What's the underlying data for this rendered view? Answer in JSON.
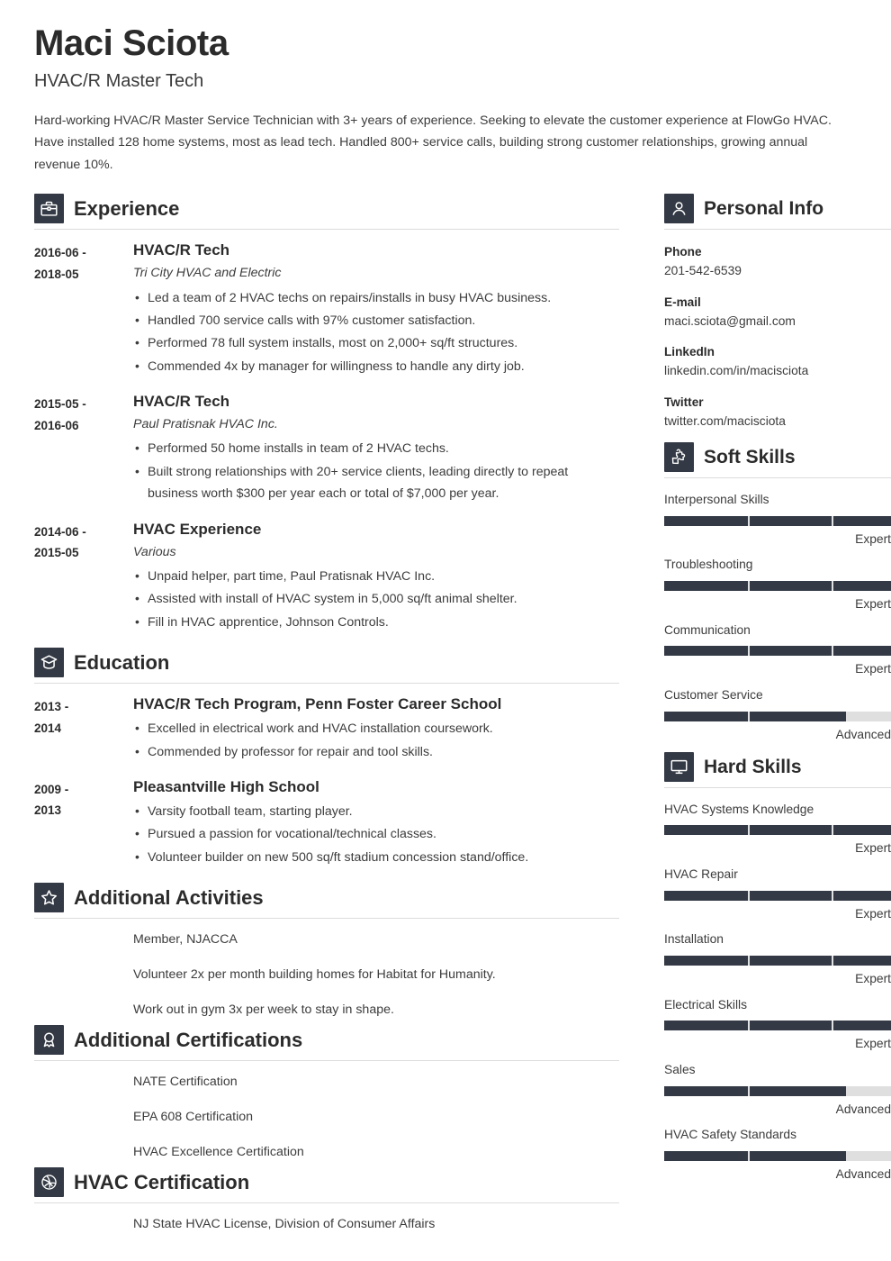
{
  "header": {
    "name": "Maci Sciota",
    "job_title": "HVAC/R Master Tech",
    "summary": "Hard-working HVAC/R Master Service Technician with 3+ years of experience. Seeking to elevate the customer experience at FlowGo HVAC. Have installed 128 home systems, most as lead tech. Handled 800+ service calls, building strong customer relationships, growing annual revenue 10%."
  },
  "theme": {
    "accent": "#343a45",
    "text": "#3c3c3c",
    "heading": "#2b2b2b",
    "rule": "#dcdcdc",
    "bar_empty": "#dfdfdf"
  },
  "sections": {
    "experience": {
      "title": "Experience",
      "icon": "briefcase-icon",
      "entries": [
        {
          "dates": "2016-06 - 2018-05",
          "date_from": "2016-06 -",
          "date_to": "2018-05",
          "title": "HVAC/R Tech",
          "org": "Tri City HVAC and Electric",
          "bullets": [
            "Led a team of 2 HVAC techs on repairs/installs in busy HVAC business.",
            "Handled 700 service calls with 97% customer satisfaction.",
            "Performed 78 full system installs, most on 2,000+ sq/ft structures.",
            "Commended 4x by manager for willingness to handle any dirty job."
          ]
        },
        {
          "dates": "2015-05 - 2016-06",
          "date_from": "2015-05 -",
          "date_to": "2016-06",
          "title": "HVAC/R Tech",
          "org": "Paul Pratisnak HVAC Inc.",
          "bullets": [
            "Performed 50 home installs in team of 2 HVAC techs.",
            "Built strong relationships with 20+ service clients, leading directly to repeat business worth $300 per year each or total of $7,000 per year."
          ]
        },
        {
          "dates": "2014-06 - 2015-05",
          "date_from": "2014-06 -",
          "date_to": "2015-05",
          "title": "HVAC Experience",
          "org": "Various",
          "bullets": [
            "Unpaid helper, part time, Paul Pratisnak HVAC Inc.",
            "Assisted with install of HVAC system in 5,000 sq/ft animal shelter.",
            "Fill in HVAC apprentice, Johnson Controls."
          ]
        }
      ]
    },
    "education": {
      "title": "Education",
      "icon": "graduation-cap-icon",
      "entries": [
        {
          "date_from": "2013 -",
          "date_to": "2014",
          "title": "HVAC/R Tech Program, Penn Foster Career School",
          "org": "",
          "bullets": [
            "Excelled in electrical work and HVAC installation coursework.",
            "Commended by professor for repair and tool skills."
          ]
        },
        {
          "date_from": "2009 -",
          "date_to": "2013",
          "title": "Pleasantville High School",
          "org": "",
          "bullets": [
            "Varsity football team, starting player.",
            "Pursued a passion for vocational/technical classes.",
            "Volunteer builder on new 500 sq/ft stadium concession stand/office."
          ]
        }
      ]
    },
    "additional_activities": {
      "title": "Additional Activities",
      "icon": "star-icon",
      "items": [
        "Member, NJACCA",
        "Volunteer 2x per month building homes for Habitat for Humanity.",
        "Work out in gym 3x per week to stay in shape."
      ]
    },
    "additional_certifications": {
      "title": "Additional Certifications",
      "icon": "award-ribbon-icon",
      "items": [
        "NATE Certification",
        "EPA 608 Certification",
        "HVAC Excellence Certification"
      ]
    },
    "hvac_certification": {
      "title": "HVAC Certification",
      "icon": "fan-ball-icon",
      "items": [
        "NJ State HVAC License, Division of Consumer Affairs"
      ]
    },
    "personal_info": {
      "title": "Personal Info",
      "icon": "person-icon",
      "fields": [
        {
          "label": "Phone",
          "value": "201-542-6539"
        },
        {
          "label": "E-mail",
          "value": "maci.sciota@gmail.com"
        },
        {
          "label": "LinkedIn",
          "value": "linkedin.com/in/macisciota"
        },
        {
          "label": "Twitter",
          "value": "twitter.com/macisciota"
        }
      ]
    },
    "soft_skills": {
      "title": "Soft Skills",
      "icon": "puzzle-piece-icon",
      "skills": [
        {
          "name": "Interpersonal Skills",
          "level": "Expert",
          "percent": 100
        },
        {
          "name": "Troubleshooting",
          "level": "Expert",
          "percent": 100
        },
        {
          "name": "Communication",
          "level": "Expert",
          "percent": 100
        },
        {
          "name": "Customer Service",
          "level": "Advanced",
          "percent": 80
        }
      ]
    },
    "hard_skills": {
      "title": "Hard Skills",
      "icon": "monitor-icon",
      "skills": [
        {
          "name": "HVAC Systems Knowledge",
          "level": "Expert",
          "percent": 100
        },
        {
          "name": "HVAC Repair",
          "level": "Expert",
          "percent": 100
        },
        {
          "name": "Installation",
          "level": "Expert",
          "percent": 100
        },
        {
          "name": "Electrical Skills",
          "level": "Expert",
          "percent": 100
        },
        {
          "name": "Sales",
          "level": "Advanced",
          "percent": 80
        },
        {
          "name": "HVAC Safety Standards",
          "level": "Advanced",
          "percent": 80
        }
      ]
    }
  }
}
